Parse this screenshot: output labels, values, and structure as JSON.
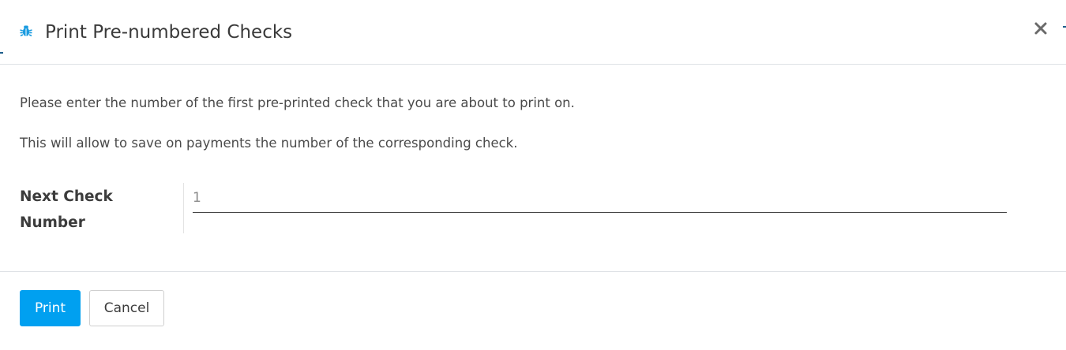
{
  "dialog": {
    "title": "Print Pre-numbered Checks",
    "title_icon": "bug-icon",
    "close_icon": "close-icon",
    "accent_color": "#00a0f0"
  },
  "body": {
    "paragraph_1": "Please enter the number of the first pre-printed check that you are about to print on.",
    "paragraph_2": "This will allow to save on payments the number of the corresponding check.",
    "field": {
      "label": "Next Check Number",
      "value": "1"
    }
  },
  "footer": {
    "print_label": "Print",
    "cancel_label": "Cancel"
  }
}
